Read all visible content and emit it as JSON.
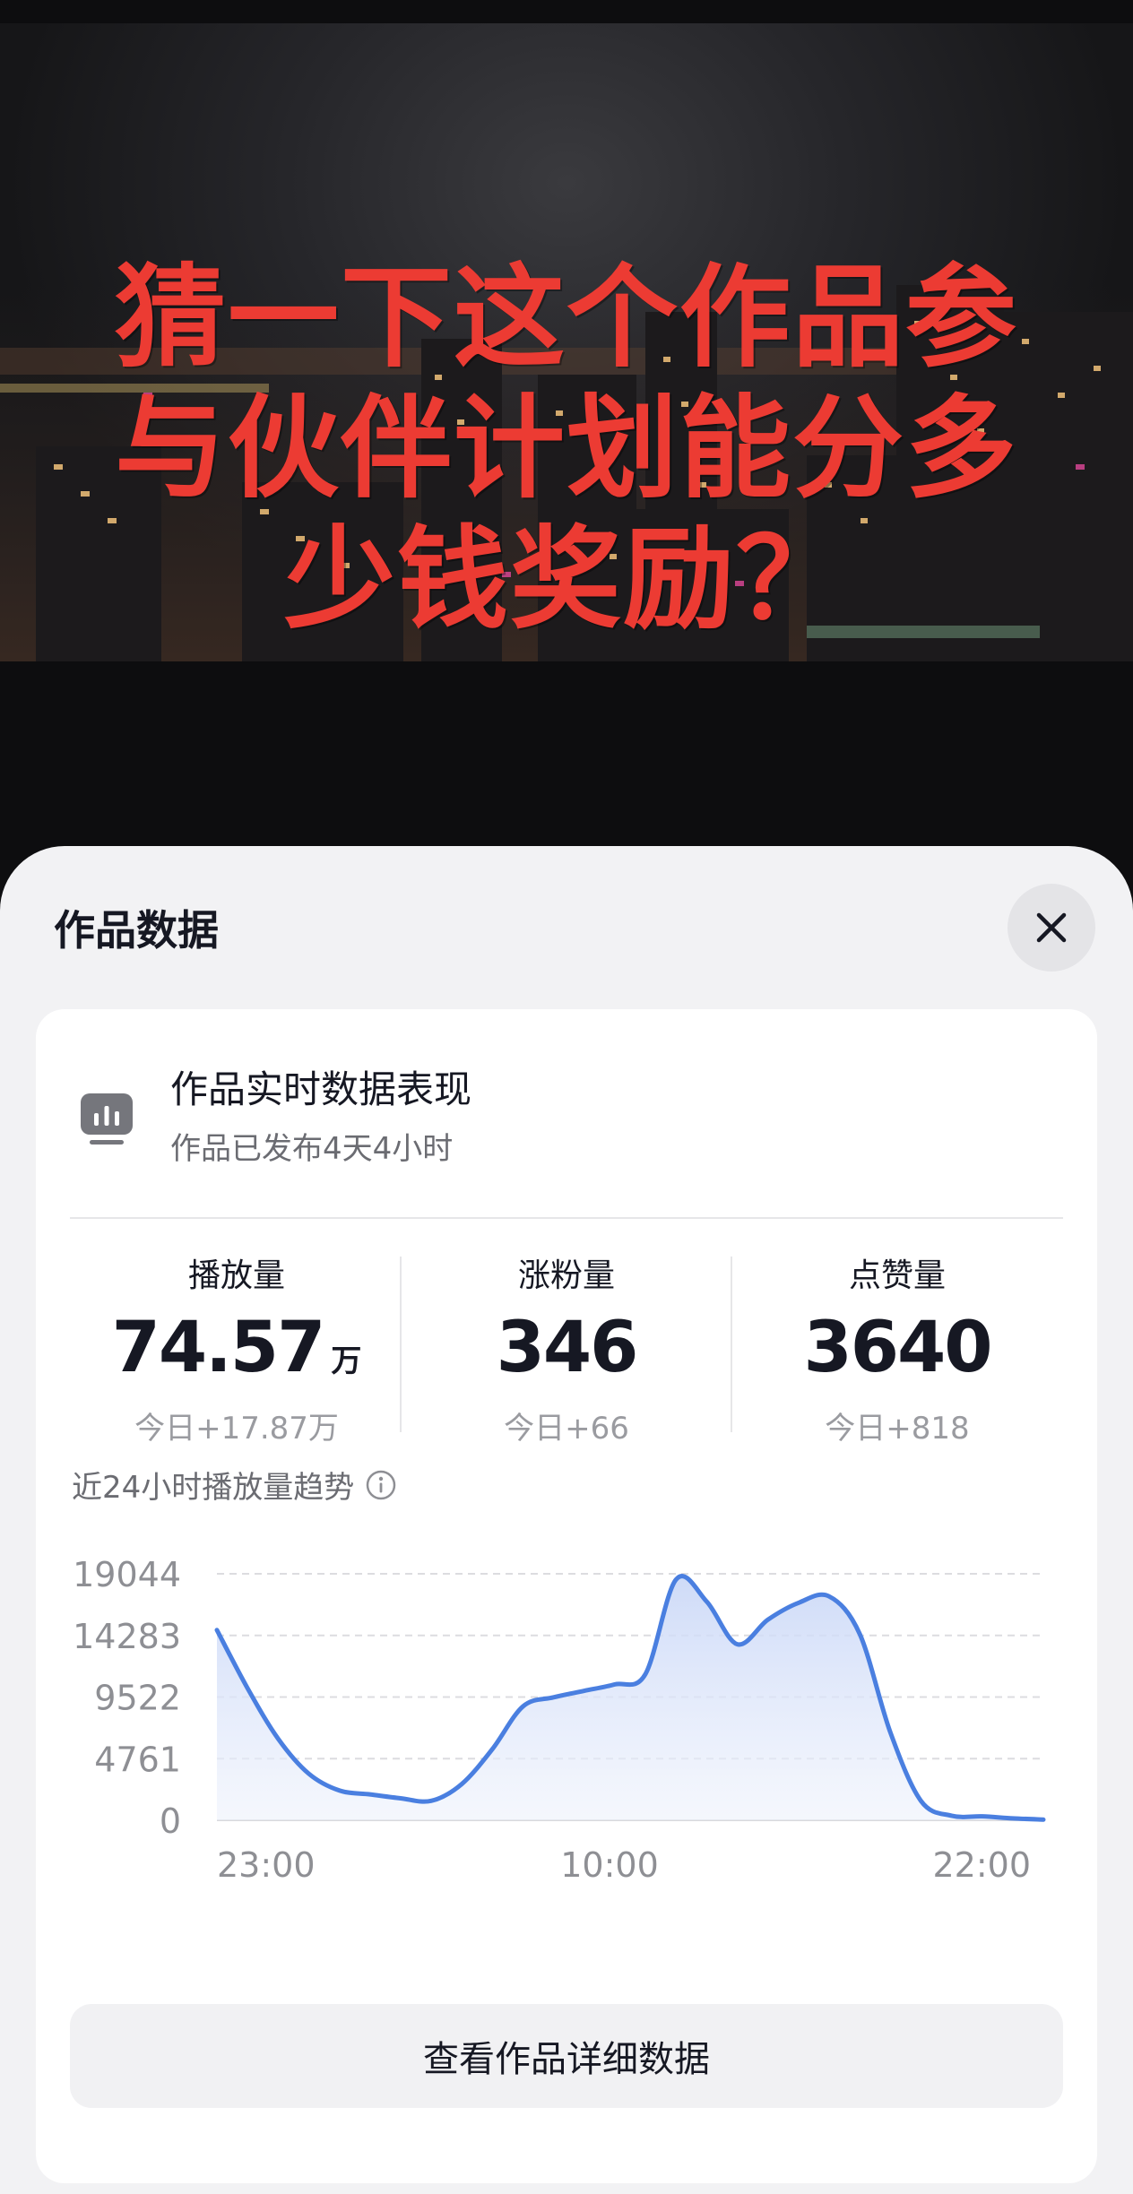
{
  "video": {
    "overlay_lines": [
      "猜一下这个作品参",
      "与伙伴计划能分多",
      "少钱奖励？"
    ]
  },
  "sheet": {
    "title": "作品数据",
    "close_icon": "close-icon"
  },
  "card": {
    "icon": "bar-chart-icon",
    "title": "作品实时数据表现",
    "subtitle": "作品已发布4天4小时"
  },
  "stats": [
    {
      "label": "播放量",
      "value": "74.57",
      "unit": "万",
      "today": "今日+17.87万"
    },
    {
      "label": "涨粉量",
      "value": "346",
      "unit": "",
      "today": "今日+66"
    },
    {
      "label": "点赞量",
      "value": "3640",
      "unit": "",
      "today": "今日+818"
    }
  ],
  "trend": {
    "label": "近24小时播放量趋势",
    "info_icon": "info-icon"
  },
  "chart_data": {
    "type": "area",
    "title": "近24小时播放量趋势",
    "y_ticks": [
      "19044",
      "14283",
      "9522",
      "4761",
      "0"
    ],
    "ylim": [
      0,
      19044
    ],
    "x_ticks": [
      "23:00",
      "10:00",
      "22:00"
    ],
    "grid": true,
    "series": [
      {
        "color": "#4a7fe0",
        "x": [
          0,
          1,
          2,
          3,
          4,
          5,
          6,
          7,
          8,
          9,
          10,
          11,
          12,
          13,
          14,
          15,
          16,
          17,
          18,
          19,
          20,
          21,
          22,
          23,
          24,
          25,
          26,
          27
        ],
        "values": [
          14700,
          10200,
          6300,
          3600,
          2300,
          2000,
          1700,
          1500,
          2800,
          5500,
          8800,
          9500,
          10000,
          10500,
          11300,
          18600,
          16900,
          13600,
          15500,
          16800,
          17300,
          14400,
          6800,
          1500,
          350,
          300,
          150,
          50
        ]
      }
    ]
  },
  "detail_button": {
    "label": "查看作品详细数据"
  }
}
